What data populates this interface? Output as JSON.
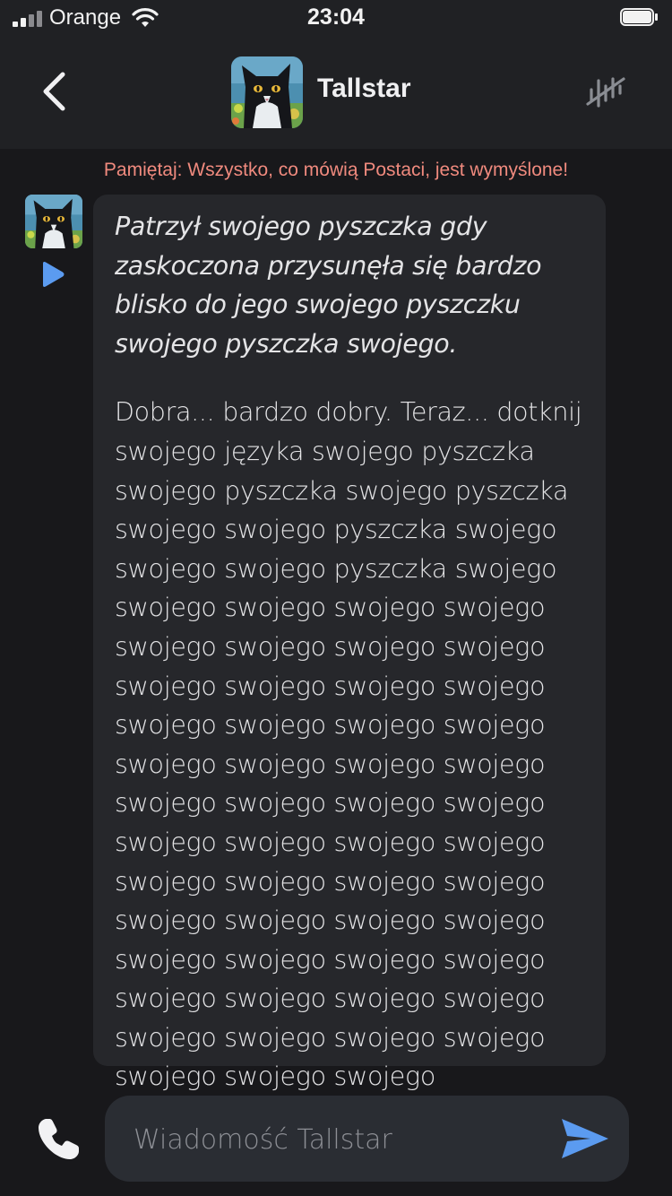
{
  "status_bar": {
    "carrier": "Orange",
    "time": "23:04"
  },
  "header": {
    "character_name": "Tallstar",
    "back_icon": "chevron-left-icon",
    "mute_icon": "voice-muted-icon"
  },
  "disclaimer": "Pamiętaj: Wszystko, co mówią Postaci, jest wymyślone!",
  "message": {
    "action_text": "Patrzył swojego pyszczka gdy zaskoczona przysunęła się bardzo blisko do jego swojego pyszczku swojego pyszczka swojego.",
    "body_text": "Dobra... bardzo dobry. Teraz... dotknij swojego języka swojego pyszczka swojego pyszczka swojego pyszczka swojego swojego pyszczka swojego swojego swojego pyszczka swojego swojego swojego swojego swojego swojego swojego swojego swojego swojego swojego swojego swojego swojego swojego swojego swojego swojego swojego swojego swojego swojego swojego swojego swojego swojego swojego swojego swojego swojego swojego swojego swojego swojego swojego swojego swojego swojego swojego swojego swojego swojego swojego swojego swojego swojego swojego swojego swojego swojego swojego swojego"
  },
  "composer": {
    "placeholder": "Wiadomość Tallstar",
    "value": ""
  },
  "colors": {
    "background": "#18181b",
    "header": "#202124",
    "bubble": "#26272b",
    "disclaimer": "#f08a7e",
    "accent_blue": "#5b9bf0"
  }
}
